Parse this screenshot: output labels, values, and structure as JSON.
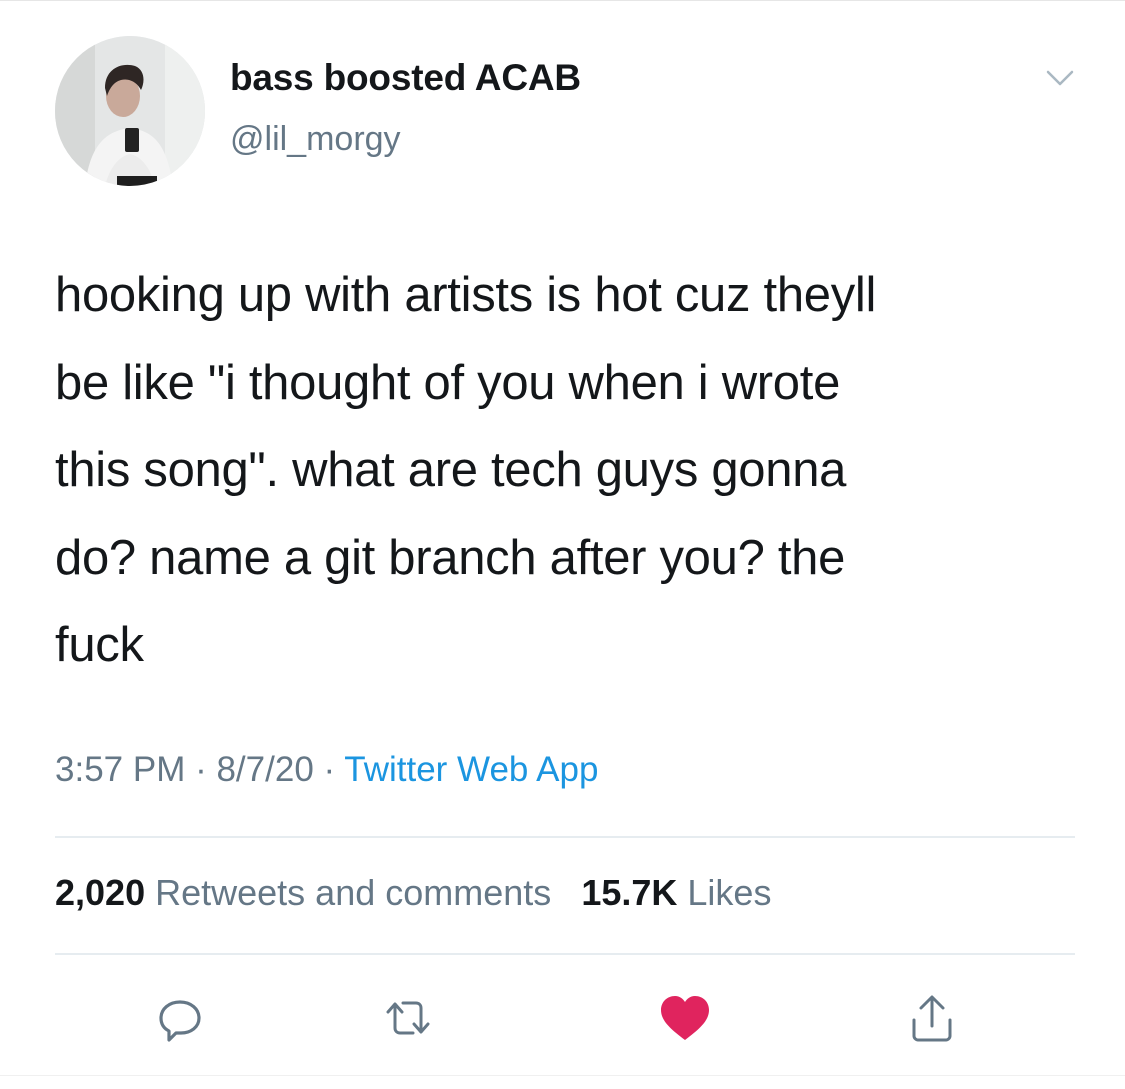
{
  "tweet": {
    "author": {
      "display_name": "bass boosted ACAB",
      "handle": "@lil_morgy"
    },
    "text": "hooking up with artists is hot cuz theyll\nbe like \"i thought of you when i wrote\nthis song\". what are tech guys gonna\ndo? name a git branch after you? the\nfuck",
    "time": "3:57 PM",
    "date": "8/7/20",
    "separator": " · ",
    "source": "Twitter Web App",
    "retweets_count": "2,020",
    "retweets_label": "Retweets and comments",
    "likes_count": "15.7K",
    "likes_label": "Likes"
  },
  "actions": [
    {
      "icon": "reply-icon"
    },
    {
      "icon": "retweet-icon"
    },
    {
      "icon": "heart-icon",
      "color": "#e0245e"
    },
    {
      "icon": "share-icon"
    }
  ],
  "colors": {
    "text_primary": "#14171a",
    "text_secondary": "#657786",
    "link": "#1b95e0",
    "like_active": "#e0245e"
  }
}
